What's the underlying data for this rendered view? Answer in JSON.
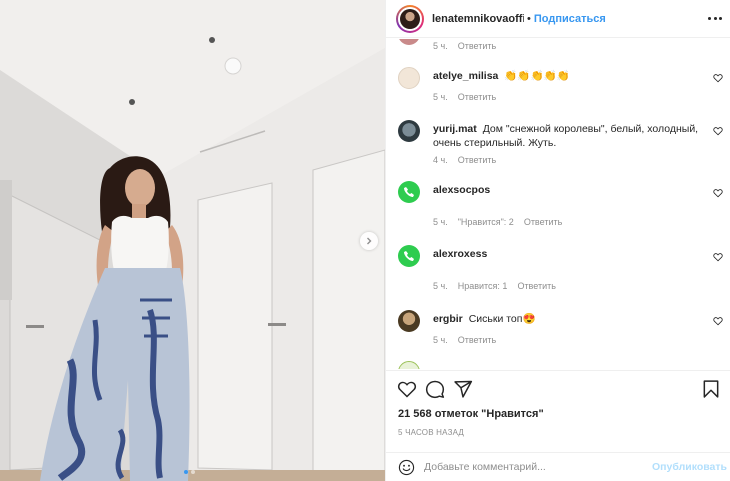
{
  "post_header": {
    "username": "lenatemnikovaoffic",
    "separator": "•",
    "follow_label": "Подписаться"
  },
  "comments": [
    {
      "username": "",
      "text": "",
      "time": "5 ч.",
      "reply": "Ответить",
      "likes": ""
    },
    {
      "username": "atelye_milisa",
      "text": "👏👏👏👏👏",
      "time": "5 ч.",
      "reply": "Ответить",
      "likes": ""
    },
    {
      "username": "yurij.mat",
      "text": "Дом \"снежной королевы\", белый, холодный, очень стерильный. Жуть.",
      "time": "4 ч.",
      "reply": "Ответить",
      "likes": ""
    },
    {
      "username": "alexsocpos",
      "text": "",
      "time": "5 ч.",
      "reply": "Ответить",
      "likes": "\"Нравится\": 2"
    },
    {
      "username": "alexroxess",
      "text": "",
      "time": "5 ч.",
      "reply": "Ответить",
      "likes": "Нравится: 1"
    },
    {
      "username": "ergbir",
      "text": "Сиськи топ😍",
      "time": "5 ч.",
      "reply": "Ответить",
      "likes": ""
    }
  ],
  "post_footer": {
    "likes": "21 568 отметок \"Нравится\"",
    "timestamp": "5 ЧАСОВ НАЗАД",
    "comment_placeholder": "Добавьте комментарий...",
    "publish_label": "Опубликовать"
  },
  "colors": {
    "accent": "#3897f0",
    "publish_disabled": "#b2dffc",
    "whatsapp": "#2ecc4f"
  },
  "icons": [
    "heart-icon",
    "comment-icon",
    "share-icon",
    "bookmark-icon",
    "emoji-icon",
    "more-icon",
    "chevron-right-icon"
  ]
}
